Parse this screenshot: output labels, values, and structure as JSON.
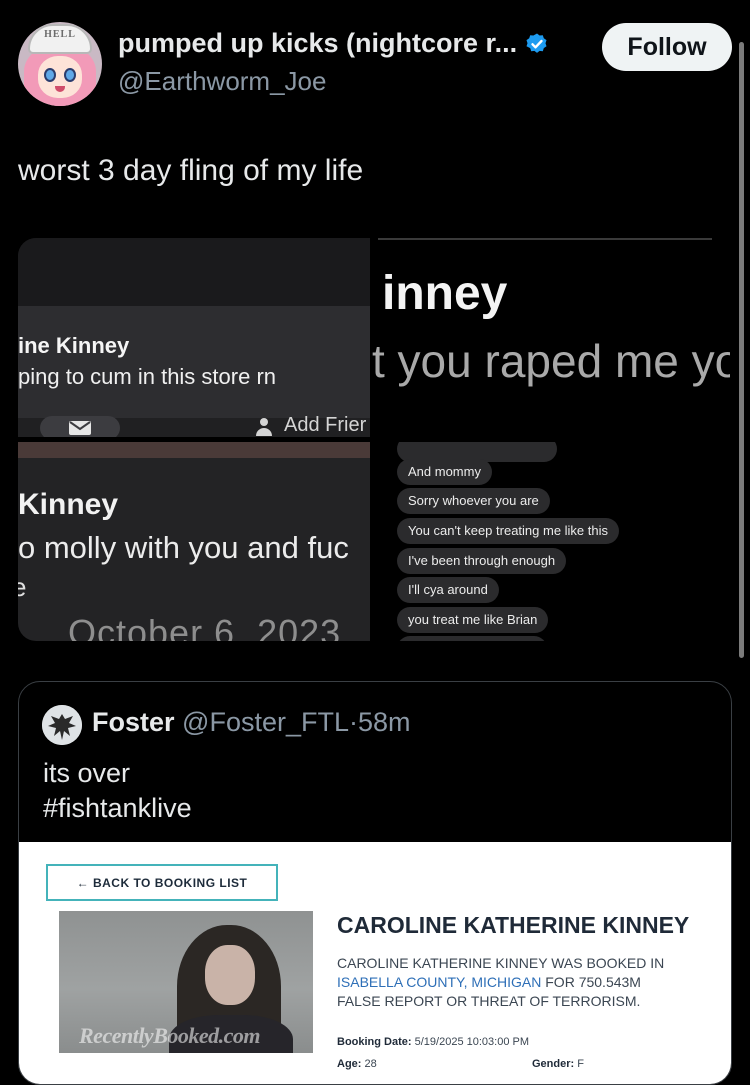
{
  "author": {
    "display_name": "pumped up kicks (nightcore r...",
    "handle": "@Earthworm_Joe",
    "avatar_hat_text": "HELL"
  },
  "follow_label": "Follow",
  "tweet_text": "worst 3 day fling of my life",
  "media": {
    "tile_a": {
      "name": "ine Kinney",
      "message": "ping to cum in this store rn",
      "add_friend": "Add Frier"
    },
    "tile_b": {
      "dots": "⁚",
      "name": "inney",
      "message": "t you raped me yo"
    },
    "tile_c": {
      "name": "Kinney",
      "message": "o molly with you and fuc",
      "message2": "e",
      "date": "October 6, 2023"
    },
    "tile_d": {
      "bubbles": [
        "And mommy",
        "Sorry whoever you are",
        "You can't keep treating me like this",
        "I've been through enough",
        "I'll cya around",
        "you treat me like Brian"
      ]
    }
  },
  "quote": {
    "name": "Foster",
    "handle": "@Foster_FTL",
    "separator": "·",
    "time": "58m",
    "text_line1": "its over",
    "text_line2": "#fishtanklive",
    "booking": {
      "back_label": "← BACK TO BOOKING LIST",
      "watermark": "RecentlyBooked.com",
      "title": "CAROLINE KATHERINE KINNEY",
      "line1": "CAROLINE KATHERINE KINNEY WAS BOOKED IN",
      "county": "ISABELLA COUNTY, MICHIGAN",
      "line2_rest": " FOR 750.543M",
      "line3": "FALSE REPORT OR THREAT OF TERRORISM.",
      "booking_date_label": "Booking Date:",
      "booking_date": "5/19/2025 10:03:00 PM",
      "age_label": "Age:",
      "age": "28",
      "gender_label": "Gender:",
      "gender": "F"
    }
  },
  "colors": {
    "background": "#000000",
    "verified": "#1d9bf0",
    "secondary_text": "#8b98a5",
    "back_button_border": "#44b3ba",
    "county_link": "#2e6fb7"
  }
}
